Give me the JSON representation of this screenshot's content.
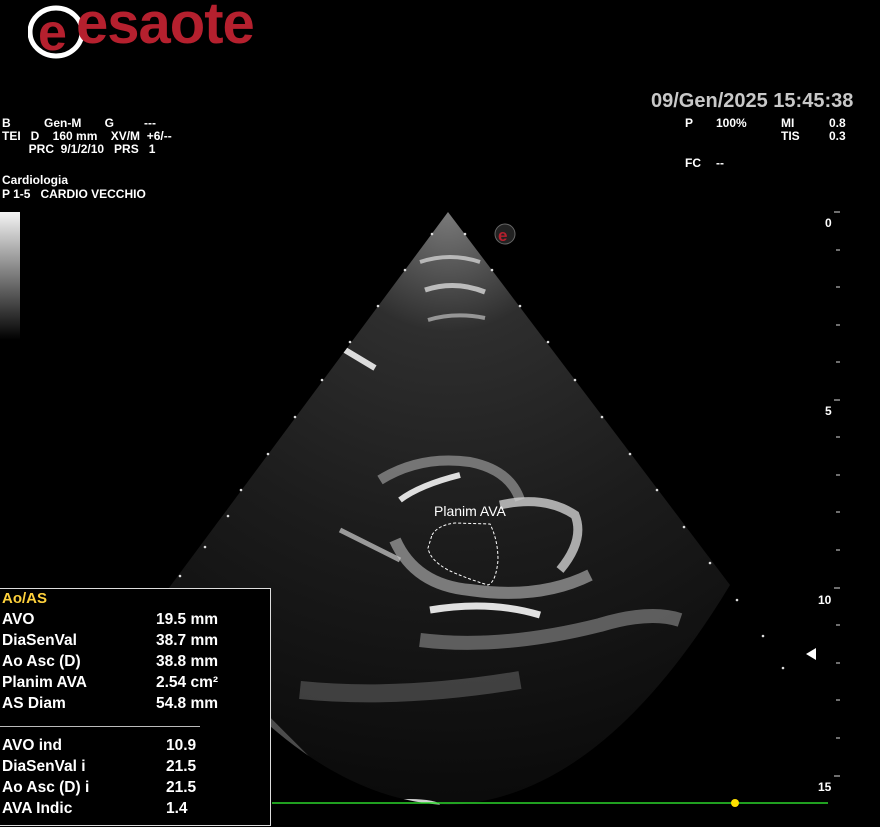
{
  "brand": {
    "name": "esaote",
    "logo_color": "#b5202e"
  },
  "header": {
    "datetime": "09/Gen/2025 15:45:38",
    "left_params": {
      "line1": "B          Gen-M       G         ---",
      "line2": "TEI   D    160 mm    XV/M  +6/--",
      "line3": "        PRC  9/1/2/10   PRS   1"
    },
    "right_params": {
      "p_label": "P",
      "p_value": "100%",
      "mi_label": "MI",
      "mi_value": "0.8",
      "tis_label": "TIS",
      "tis_value": "0.3",
      "fc_label": "FC",
      "fc_value": "--"
    },
    "preset": "Cardiologia",
    "probe": "P 1-5   CARDIO VECCHIO"
  },
  "depth_scale": {
    "labels": [
      "0",
      "5",
      "10",
      "15"
    ],
    "unit": "cm"
  },
  "image": {
    "roi_label": "Planim AVA"
  },
  "measurements": {
    "title": "Ao/AS",
    "rows": [
      {
        "name": "AVO",
        "value": "19.5 mm"
      },
      {
        "name": "DiaSenVal",
        "value": "38.7 mm"
      },
      {
        "name": "Ao Asc (D)",
        "value": "38.8 mm"
      },
      {
        "name": "Planim AVA",
        "value": "2.54 cm²"
      },
      {
        "name": "AS Diam",
        "value": "54.8 mm"
      }
    ],
    "index_rows": [
      {
        "name": "AVO ind",
        "value": "10.9"
      },
      {
        "name": "DiaSenVal i",
        "value": "21.5"
      },
      {
        "name": "Ao Asc (D) i",
        "value": "21.5"
      },
      {
        "name": "AVA Indic",
        "value": "1.4"
      }
    ]
  },
  "colors": {
    "ecg_line": "#2bd42b",
    "ecg_marker": "#ffe000",
    "title_yellow": "#ffd23c"
  }
}
